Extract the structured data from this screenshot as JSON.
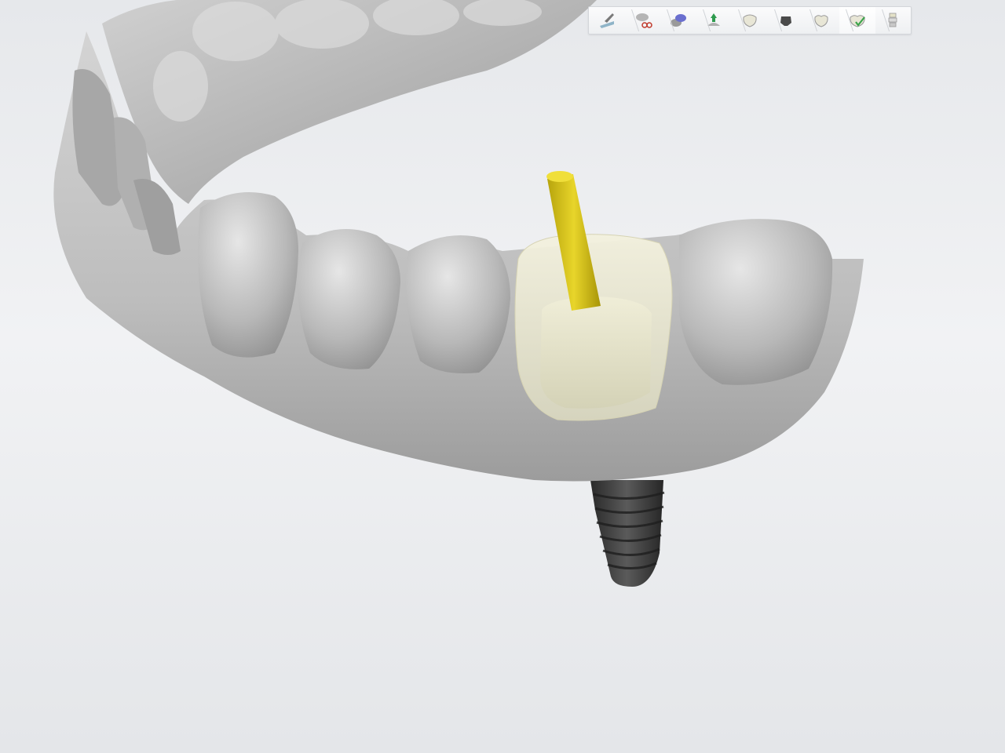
{
  "toolbar": {
    "steps": [
      {
        "name": "scan-step",
        "icon": "scalpel-scan-icon"
      },
      {
        "name": "cut-step",
        "icon": "scissors-model-icon"
      },
      {
        "name": "align-step",
        "icon": "align-models-icon"
      },
      {
        "name": "margin-step",
        "icon": "margin-line-icon"
      },
      {
        "name": "crown-step",
        "icon": "crown-icon"
      },
      {
        "name": "abutment-step",
        "icon": "abutment-icon"
      },
      {
        "name": "anatomy-step",
        "icon": "anatomy-tooth-icon"
      },
      {
        "name": "finish-step",
        "icon": "check-tooth-icon",
        "active": true
      },
      {
        "name": "output-step",
        "icon": "stack-output-icon"
      }
    ]
  },
  "colors": {
    "gum": "#bcbcbc",
    "tooth": "#c9c9c9",
    "crown": "#ece9d0",
    "axis": "#d8c51a",
    "implant": "#3a3a3a"
  }
}
